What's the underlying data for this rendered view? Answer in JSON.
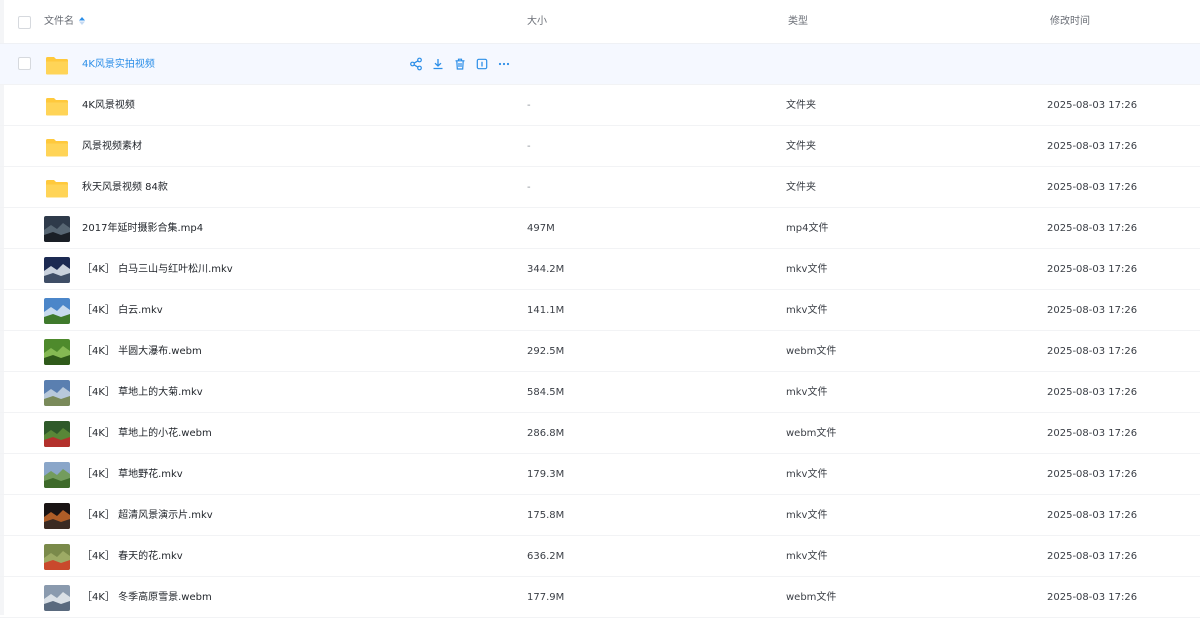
{
  "header": {
    "name": "文件名",
    "size": "大小",
    "type": "类型",
    "modified": "修改时间"
  },
  "accent_color": "#2b8ee8",
  "folder_color": "#ffc93c",
  "rows": [
    {
      "kind": "folder",
      "name": "4K风景实拍视频",
      "size": "",
      "type": "",
      "modified": "",
      "hovered": true,
      "actions": [
        "share-icon",
        "download-icon",
        "delete-icon",
        "info-icon",
        "more-icon"
      ]
    },
    {
      "kind": "folder",
      "name": "4K风景视频",
      "size": "-",
      "type": "文件夹",
      "modified": "2025-08-03 17:26"
    },
    {
      "kind": "folder",
      "name": "风景视频素材",
      "size": "-",
      "type": "文件夹",
      "modified": "2025-08-03 17:26"
    },
    {
      "kind": "folder",
      "name": "秋天风景视频 84款",
      "size": "-",
      "type": "文件夹",
      "modified": "2025-08-03 17:26"
    },
    {
      "kind": "video",
      "thumb": [
        "#2e3a4a",
        "#5e6e7a",
        "#1a1f26"
      ],
      "name": "2017年延时摄影合集.mp4",
      "size": "497M",
      "type": "mp4文件",
      "modified": "2025-08-03 17:26"
    },
    {
      "kind": "video",
      "thumb": [
        "#1c2a52",
        "#e8eef5",
        "#3f4e66"
      ],
      "name": "［4K］ 白马三山与红叶松川.mkv",
      "size": "344.2M",
      "type": "mkv文件",
      "modified": "2025-08-03 17:26"
    },
    {
      "kind": "video",
      "thumb": [
        "#4b86c9",
        "#dde9f5",
        "#3f7a2c"
      ],
      "name": "［4K］ 白云.mkv",
      "size": "141.1M",
      "type": "mkv文件",
      "modified": "2025-08-03 17:26"
    },
    {
      "kind": "video",
      "thumb": [
        "#4e8a2c",
        "#8fc15a",
        "#2f5a1a"
      ],
      "name": "［4K］ 半圆大瀑布.webm",
      "size": "292.5M",
      "type": "webm文件",
      "modified": "2025-08-03 17:26"
    },
    {
      "kind": "video",
      "thumb": [
        "#5a7fb0",
        "#c9d6e3",
        "#7a8a5a"
      ],
      "name": "［4K］ 草地上的大菊.mkv",
      "size": "584.5M",
      "type": "mkv文件",
      "modified": "2025-08-03 17:26"
    },
    {
      "kind": "video",
      "thumb": [
        "#2f5a2a",
        "#5f8f3a",
        "#b3312c"
      ],
      "name": "［4K］ 草地上的小花.webm",
      "size": "286.8M",
      "type": "webm文件",
      "modified": "2025-08-03 17:26"
    },
    {
      "kind": "video",
      "thumb": [
        "#8aa6c9",
        "#6f9a4a",
        "#3e6a2a"
      ],
      "name": "［4K］ 草地野花.mkv",
      "size": "179.3M",
      "type": "mkv文件",
      "modified": "2025-08-03 17:26"
    },
    {
      "kind": "video",
      "thumb": [
        "#1a1414",
        "#c96a2a",
        "#3a2a22"
      ],
      "name": "［4K］ 超清风景演示片.mkv",
      "size": "175.8M",
      "type": "mkv文件",
      "modified": "2025-08-03 17:26"
    },
    {
      "kind": "video",
      "thumb": [
        "#7a8a4a",
        "#a3b06a",
        "#c9492c"
      ],
      "name": "［4K］ 春天的花.mkv",
      "size": "636.2M",
      "type": "mkv文件",
      "modified": "2025-08-03 17:26"
    },
    {
      "kind": "video",
      "thumb": [
        "#8a9aae",
        "#e8ecf0",
        "#5a6a7e"
      ],
      "name": "［4K］ 冬季高原雪景.webm",
      "size": "177.9M",
      "type": "webm文件",
      "modified": "2025-08-03 17:26"
    }
  ]
}
